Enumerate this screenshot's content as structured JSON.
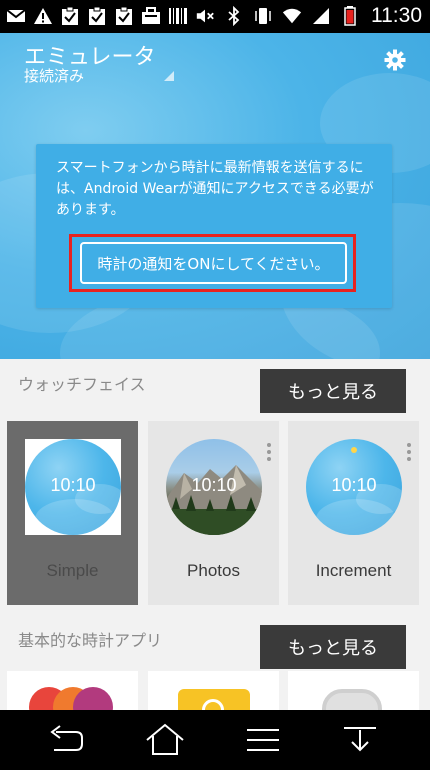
{
  "status_bar": {
    "time": "11:30",
    "left_icons": [
      "gmail-icon",
      "warning-icon",
      "clipboard-check-icon",
      "clipboard-check-icon",
      "clipboard-check-icon",
      "briefcase-icon",
      "barcode-icon"
    ],
    "right_icons": [
      "mute-icon",
      "bluetooth-icon",
      "vibrate-icon",
      "wifi-icon",
      "signal-icon",
      "battery-icon"
    ]
  },
  "app_bar": {
    "title": "エミュレータ",
    "subtitle": "接続済み"
  },
  "notice": {
    "message": "スマートフォンから時計に最新情報を送信するには、Android Wearが通知にアクセスできる必要があります。",
    "button_label": "時計の通知をONにしてください。"
  },
  "watch_faces": {
    "section_title": "ウォッチフェイス",
    "more_label": "もっと見る",
    "items": [
      {
        "label": "Simple",
        "time": "10:10",
        "selected": true
      },
      {
        "label": "Photos",
        "time": "10:10",
        "selected": false
      },
      {
        "label": "Increment",
        "time": "10:10",
        "selected": false
      }
    ]
  },
  "watch_apps": {
    "section_title": "基本的な時計アプリ",
    "more_label": "もっと見る"
  },
  "colors": {
    "hero_blue": "#3aa3dc",
    "notice_blue": "#40aee6",
    "highlight_red": "#e8231f",
    "more_button_bg": "#3a3a3a"
  }
}
